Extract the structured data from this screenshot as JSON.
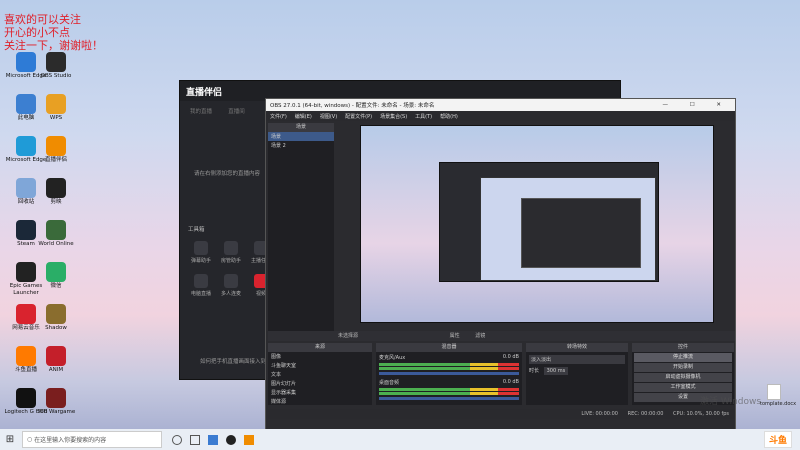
{
  "overlay": {
    "line1": "喜欢的可以关注",
    "line2": "开心的小不点",
    "line3": "关注一下，谢谢啦！"
  },
  "desktop_icons": [
    {
      "label": "Microsoft Edge",
      "color": "#2e7bd6"
    },
    {
      "label": "OBS Studio",
      "color": "#2b2b2b"
    },
    {
      "label": "此电脑",
      "color": "#3c7fd1"
    },
    {
      "label": "WPS",
      "color": "#e8a023"
    },
    {
      "label": "Microsoft Edge",
      "color": "#1f9bd7"
    },
    {
      "label": "直播伴侣",
      "color": "#f08c00"
    },
    {
      "label": "回收站",
      "color": "#7fa6d8"
    },
    {
      "label": "剪映",
      "color": "#222"
    },
    {
      "label": "Steam",
      "color": "#1b2838"
    },
    {
      "label": "World Online",
      "color": "#3a6a3a"
    },
    {
      "label": "Epic Games Launcher",
      "color": "#222"
    },
    {
      "label": "微信",
      "color": "#2aae67"
    },
    {
      "label": "网易云音乐",
      "color": "#d9232e"
    },
    {
      "label": "Shadow",
      "color": "#8a6d2e"
    },
    {
      "label": "斗鱼直播",
      "color": "#ff7a00"
    },
    {
      "label": "ANIM",
      "color": "#c41f2a"
    },
    {
      "label": "Logitech G HUB",
      "color": "#111"
    },
    {
      "label": "360 Wargame",
      "color": "#7a1e1e"
    }
  ],
  "helper": {
    "app_name": "直播伴侣",
    "tabs": [
      "我的直播",
      "直播间"
    ],
    "center_text": "请在右侧添加您的直播内容",
    "tools_title": "工具箱",
    "tools": [
      "弹幕助手",
      "房管助手",
      "主播任务",
      "电脑直播",
      "多人连麦",
      "视频",
      "小窗口",
      "更多"
    ],
    "footer": "如何把手机直播画面接入到电脑"
  },
  "obs": {
    "title": "OBS 27.0.1 (64-bit, windows) - 配置文件: 未命名 - 场景: 未命名",
    "menu": [
      "文件(F)",
      "编辑(E)",
      "视图(V)",
      "配置文件(P)",
      "场景集合(S)",
      "工具(T)",
      "帮助(H)"
    ],
    "scenes_header": "场景",
    "scenes": [
      "场景",
      "场景 2"
    ],
    "no_source": "未选择源",
    "properties": "属性",
    "filters": "滤镜",
    "sources_header": "来源",
    "sources": [
      "图像",
      "斗鱼聊天室",
      "文本",
      "图片幻灯片",
      "显示器采集",
      "媒体源"
    ],
    "mixer_header": "混音器",
    "mixer": [
      {
        "name": "麦克风/Aux",
        "db": "0.0 dB"
      },
      {
        "name": "桌面音频",
        "db": "0.0 dB"
      }
    ],
    "transition_header": "转场特效",
    "transition": "淡入淡出",
    "duration_label": "时长",
    "duration": "300 ms",
    "controls_header": "控件",
    "controls": [
      "停止推流",
      "开始录制",
      "启动虚拟摄像机",
      "工作室模式",
      "设置",
      "退出"
    ],
    "status": {
      "live": "LIVE: 00:00:00",
      "rec": "REC: 00:00:00",
      "cpu": "CPU: 10.0%, 30.00 fps"
    }
  },
  "desktop_file": "tomplate.docx",
  "watermark": "激活 Windows",
  "taskbar": {
    "search_placeholder": "在这里输入你要搜索的内容",
    "time": "",
    "logo": "斗鱼"
  }
}
